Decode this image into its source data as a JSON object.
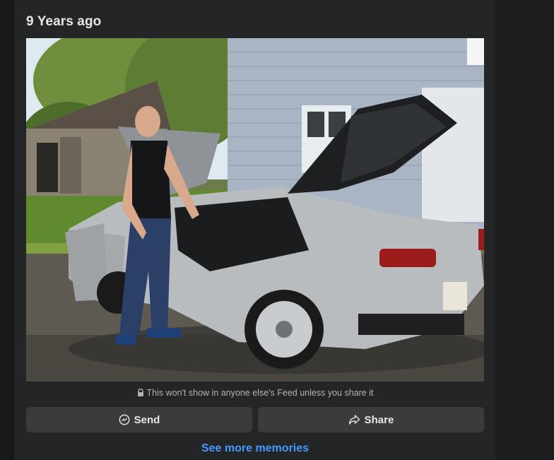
{
  "memory": {
    "title": "9 Years ago",
    "photo_alt": "Man standing next to a silver sports car with open doors and hatch",
    "privacy_text": "This won't show in anyone else's Feed unless you share it",
    "actions": {
      "send_label": "Send",
      "share_label": "Share"
    },
    "see_more_label": "See more memories"
  },
  "icons": {
    "privacy": "lock-icon",
    "send": "messenger-icon",
    "share": "share-arrow-icon"
  },
  "colors": {
    "card_bg": "#242526",
    "button_bg": "#3a3b3c",
    "link": "#4599ff",
    "text_primary": "#e4e6eb",
    "text_secondary": "#b0b3b8"
  }
}
